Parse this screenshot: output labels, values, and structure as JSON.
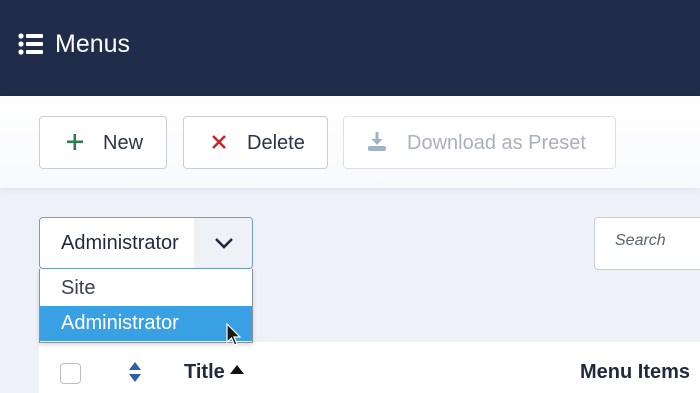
{
  "header": {
    "title": "Menus",
    "icon": "list-icon",
    "bg_color": "#1f2d4a"
  },
  "toolbar": {
    "new_label": "New",
    "delete_label": "Delete",
    "preset_label": "Download as Preset",
    "new_icon_color": "#2e7d4f",
    "delete_icon_color": "#c62828"
  },
  "filter": {
    "selected": "Administrator",
    "options": [
      "Site",
      "Administrator"
    ],
    "highlight_color": "#3aa0e4"
  },
  "search": {
    "placeholder": "Search"
  },
  "table": {
    "columns": {
      "title": "Title",
      "menu_items": "Menu Items"
    }
  }
}
